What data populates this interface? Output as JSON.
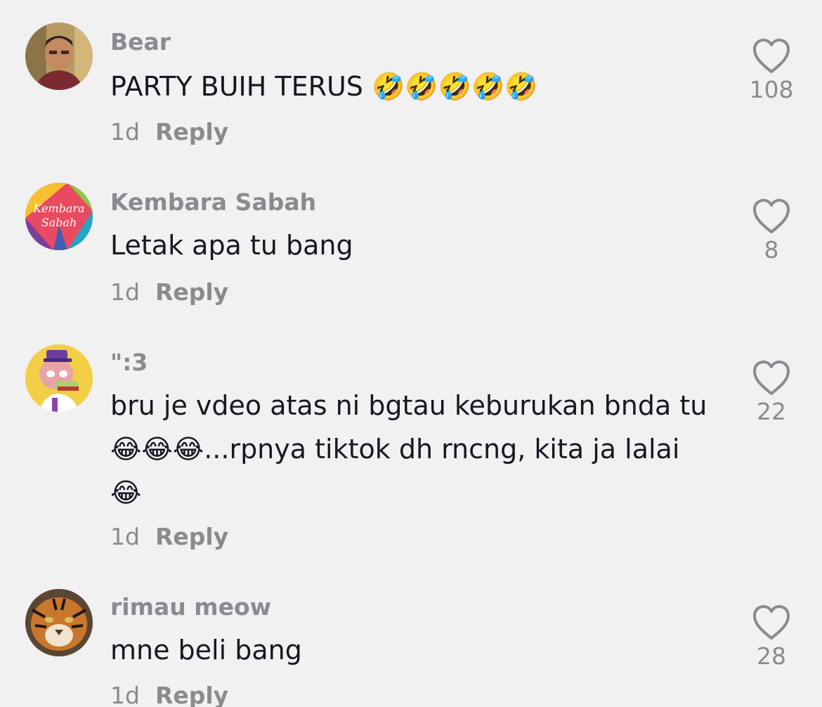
{
  "comments": [
    {
      "username": "Bear",
      "text": "PARTY BUIH TERUS 🤣🤣🤣🤣🤣",
      "time": "1d",
      "reply_label": "Reply",
      "likes": "108"
    },
    {
      "username": "Kembara Sabah",
      "text": "Letak apa tu bang",
      "time": "1d",
      "reply_label": "Reply",
      "likes": "8",
      "avatar_text_1": "Kembara",
      "avatar_text_2": "Sabah"
    },
    {
      "username": "\":3",
      "text": "bru je vdeo atas ni bgtau keburukan bnda tu 😂😂😂...rpnya tiktok dh rncng, kita ja lalai 😂",
      "time": "1d",
      "reply_label": "Reply",
      "likes": "22"
    },
    {
      "username": "rimau meow",
      "text": "mne beli bang",
      "time": "1d",
      "reply_label": "Reply",
      "likes": "28"
    }
  ],
  "icons": {
    "like": "heart-outline-icon"
  },
  "colors": {
    "background": "#f1f1f2",
    "text": "#161823",
    "secondary": "#8a8b91"
  }
}
